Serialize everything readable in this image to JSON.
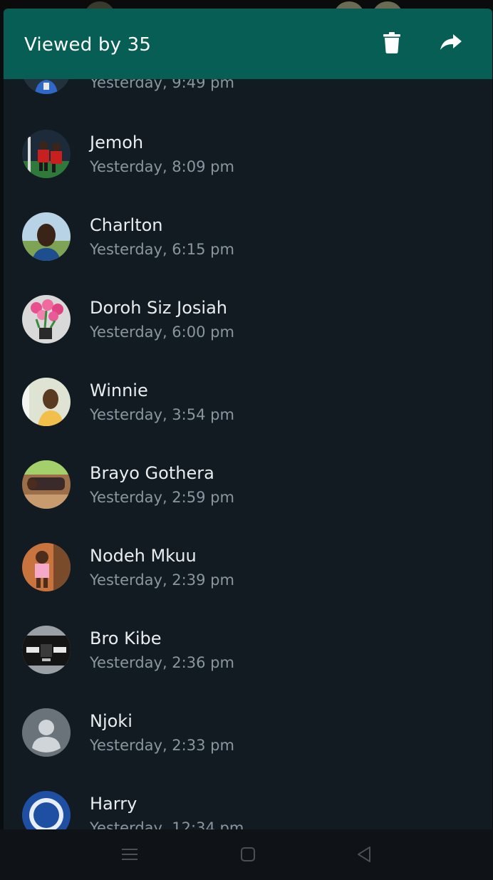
{
  "header": {
    "title": "Viewed by 35",
    "actions": [
      {
        "name": "delete",
        "icon": "trash-icon"
      },
      {
        "name": "forward",
        "icon": "forward-arrow-icon"
      }
    ],
    "color": "#075e54"
  },
  "viewers": [
    {
      "name": "",
      "time": "Yesterday, 9:49 pm",
      "avatar_icon": "profile-photo"
    },
    {
      "name": "Jemoh",
      "time": "Yesterday, 8:09 pm",
      "avatar_icon": "profile-photo"
    },
    {
      "name": "Charlton",
      "time": "Yesterday, 6:15 pm",
      "avatar_icon": "profile-photo"
    },
    {
      "name": "Doroh Siz Josiah",
      "time": "Yesterday, 6:00 pm",
      "avatar_icon": "profile-photo"
    },
    {
      "name": "Winnie",
      "time": "Yesterday, 3:54 pm",
      "avatar_icon": "profile-photo"
    },
    {
      "name": "Brayo Gothera",
      "time": "Yesterday, 2:59 pm",
      "avatar_icon": "profile-photo"
    },
    {
      "name": "Nodeh Mkuu",
      "time": "Yesterday, 2:39 pm",
      "avatar_icon": "profile-photo"
    },
    {
      "name": "Bro Kibe",
      "time": "Yesterday, 2:36 pm",
      "avatar_icon": "profile-photo"
    },
    {
      "name": "Njoki",
      "time": "Yesterday, 2:33 pm",
      "avatar_icon": "default-avatar-icon"
    },
    {
      "name": "Harry",
      "time": "Yesterday, 12:34 pm",
      "avatar_icon": "profile-photo"
    }
  ],
  "navbar": {
    "buttons": [
      "menu-icon",
      "home-icon",
      "back-icon"
    ]
  }
}
